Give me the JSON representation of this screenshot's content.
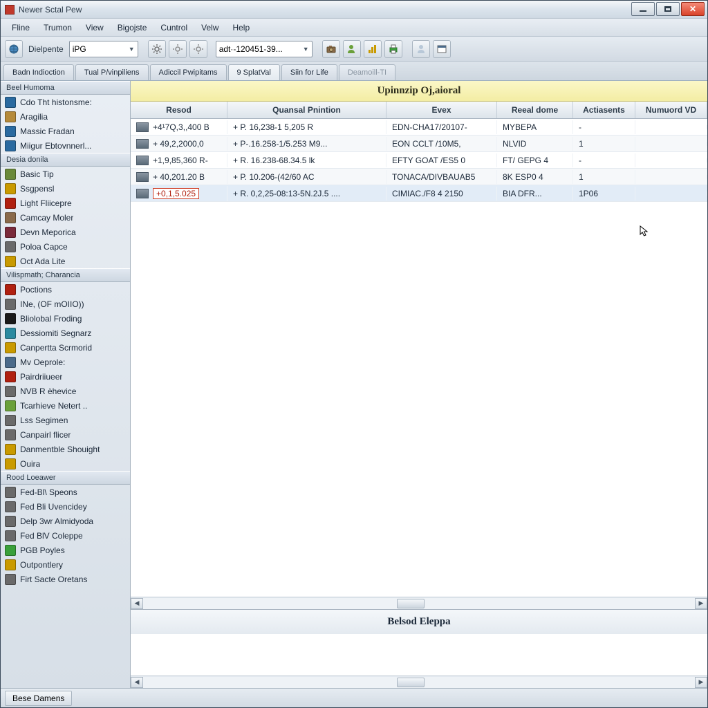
{
  "window": {
    "title": "Newer Sctal Pew"
  },
  "menubar": [
    "Fline",
    "Trumon",
    "View",
    "Bigojste",
    "Cuntrol",
    "Velw",
    "Help"
  ],
  "toolbar": {
    "diepente_label": "Dielpente",
    "diepente_value": "iPG",
    "id_value": "adt·-120451-39..."
  },
  "tabs": [
    {
      "label": "Badn Indioction",
      "state": "normal"
    },
    {
      "label": "Tual P/vinpiliens",
      "state": "normal"
    },
    {
      "label": "Adiccil Pwipitams",
      "state": "normal"
    },
    {
      "label": "9 SplatVal",
      "state": "active"
    },
    {
      "label": "Siin for Life",
      "state": "normal"
    },
    {
      "label": "Deamoill-TI",
      "state": "disabled"
    }
  ],
  "sidebar": {
    "groups": [
      {
        "header": "Beel Humoma",
        "items": [
          {
            "label": "Cdo Tht histonsme:",
            "color": "#2a6aa0"
          },
          {
            "label": "Aragilia",
            "color": "#b58a3a"
          },
          {
            "label": "Massic Fradan",
            "color": "#2a6aa0"
          },
          {
            "label": "Miigur Ebtovnnerl...",
            "color": "#2a6aa0"
          }
        ]
      },
      {
        "header": "Desia donila",
        "items": [
          {
            "label": "Basic Tip",
            "color": "#6a8a3a"
          },
          {
            "label": "Ssgpensl",
            "color": "#c99a00"
          },
          {
            "label": "Light Fliicepre",
            "color": "#b02010"
          },
          {
            "label": "Camcay Moler",
            "color": "#8a6a4a"
          },
          {
            "label": "Devn Meporica",
            "color": "#7a2a3a"
          },
          {
            "label": "Poloa Capce",
            "color": "#6a6a6a"
          },
          {
            "label": "Oct Ada Lite",
            "color": "#c99a00"
          }
        ]
      },
      {
        "header": "Vilispmath; Charancia",
        "items": [
          {
            "label": "Poctions",
            "color": "#b02010"
          },
          {
            "label": "INe, (OF mOIIO))",
            "color": "#6a6a6a"
          },
          {
            "label": "Bliolobal Froding",
            "color": "#1a1a1a"
          },
          {
            "label": "Dessiomiti Segnarz",
            "color": "#2a8aa0"
          },
          {
            "label": "Canpertta Scrmorid",
            "color": "#c99a00"
          },
          {
            "label": "Mv Oeprole:",
            "color": "#4a6a8a"
          },
          {
            "label": "Pairdriiueer",
            "color": "#b02010"
          },
          {
            "label": "NVB R èhevice",
            "color": "#6a6a6a"
          },
          {
            "label": "Tcarhieve Netert ..",
            "color": "#6aa03a"
          },
          {
            "label": "Lss Segimen",
            "color": "#6a6a6a"
          },
          {
            "label": "Canpairl flicer",
            "color": "#6a6a6a"
          },
          {
            "label": "Danmentble Shouight",
            "color": "#c99a00"
          },
          {
            "label": "Ouira",
            "color": "#c99a00"
          }
        ]
      },
      {
        "header": "Rood Loeawer",
        "items": [
          {
            "label": "Fed-Bl\\ Speons",
            "color": "#6a6a6a"
          },
          {
            "label": "Fed Bli Uvencidey",
            "color": "#6a6a6a"
          },
          {
            "label": "Delp 3wr Almidyoda",
            "color": "#6a6a6a"
          },
          {
            "label": "Fed BlV Coleppe",
            "color": "#6a6a6a"
          },
          {
            "label": "PGB Poyles",
            "color": "#3aa03a"
          },
          {
            "label": "Outpontlery",
            "color": "#c99a00"
          },
          {
            "label": "Firt Sacte Oretans",
            "color": "#6a6a6a"
          }
        ]
      }
    ]
  },
  "main": {
    "title": "Upinnzip Oj,aioral",
    "columns": [
      "Resod",
      "Quansal Pnintion",
      "Evex",
      "Reeal dome",
      "Actiasents",
      "Numuord VD"
    ],
    "rows": [
      {
        "r": "+4¹7Q,3,,400 B",
        "q": "+ P. 16,238-1 5,205 R",
        "e": "EDN-CHA17/20107-",
        "d": "MYBEPA",
        "a": "-",
        "n": ""
      },
      {
        "r": "+ 49,2,2000,0",
        "q": "+ P-.16.258-1/5.253 M9...",
        "e": "EON CCLT /10M5,",
        "d": "NLVID",
        "a": "1",
        "n": ""
      },
      {
        "r": "+1,9,85,360 R-",
        "q": "+ R. 16.238-68.34.5 lk",
        "e": "EFTY GOAT /ES5 0",
        "d": "FT/ GEPG 4",
        "a": "-",
        "n": ""
      },
      {
        "r": "+ 40,201.20 B",
        "q": "+ P. 10.206-(42/60 AC",
        "e": "TONACA/DIVBAUAB5",
        "d": "8K ESP0 4",
        "a": "1",
        "n": ""
      },
      {
        "r": "+0,1,5.025",
        "q": "+ R. 0,2,25-08:13-5N.2J.5 ....",
        "e": "CIMIAC./F8 4 2150",
        "d": "BIA DFR...",
        "a": "1P06",
        "n": "",
        "sel": true,
        "boxed": true
      }
    ],
    "detail_title": "Belsod Eleppa"
  },
  "status": {
    "button": "Bese Damens"
  }
}
